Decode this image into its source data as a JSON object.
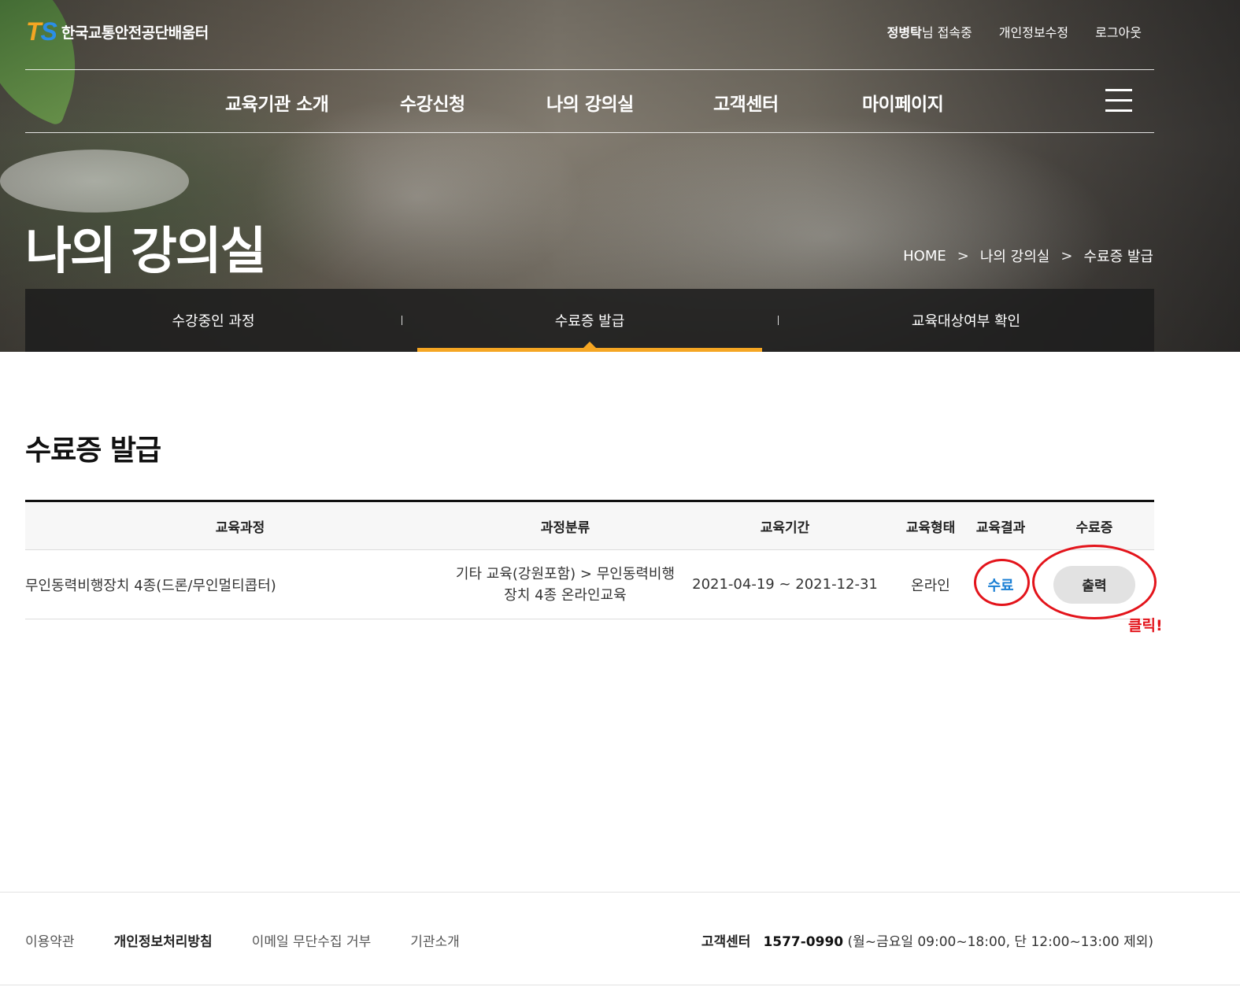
{
  "brand": {
    "logo_t": "T",
    "logo_s": "S",
    "name": "한국교통안전공단배움터"
  },
  "util_nav": {
    "user_name": "정병탁",
    "user_suffix": "님 접속중",
    "edit_profile": "개인정보수정",
    "logout": "로그아웃"
  },
  "main_nav": [
    "교육기관 소개",
    "수강신청",
    "나의 강의실",
    "고객센터",
    "마이페이지"
  ],
  "page_title": "나의 강의실",
  "breadcrumb": {
    "home": "HOME",
    "level1": "나의 강의실",
    "level2": "수료증 발급",
    "sep": ">"
  },
  "subtabs": [
    "수강중인 과정",
    "수료증 발급",
    "교육대상여부 확인"
  ],
  "section_title": "수료증 발급",
  "table": {
    "headers": [
      "교육과정",
      "과정분류",
      "교육기간",
      "교육형태",
      "교육결과",
      "수료증"
    ],
    "rows": [
      {
        "course": "무인동력비행장치 4종(드론/무인멀티콥터)",
        "category_line1": "기타 교육(강원포함) > 무인동력비행",
        "category_line2": "장치 4종 온라인교육",
        "period": "2021-04-19 ~ 2021-12-31",
        "type": "온라인",
        "result": "수료",
        "certificate_button": "출력"
      }
    ]
  },
  "annotation": "클릭!",
  "footer": {
    "links": [
      "이용약관",
      "개인정보처리방침",
      "이메일 무단수집 거부",
      "기관소개"
    ],
    "contact_label": "고객센터",
    "contact_tel": "1577-0990",
    "contact_hours": "(월~금요일 09:00~18:00, 단 12:00~13:00 제외)"
  },
  "colors": {
    "accent_orange": "#f5a623",
    "logo_blue": "#2a8ee8",
    "link_blue": "#1a7fd4",
    "annotation_red": "#e3141b"
  }
}
